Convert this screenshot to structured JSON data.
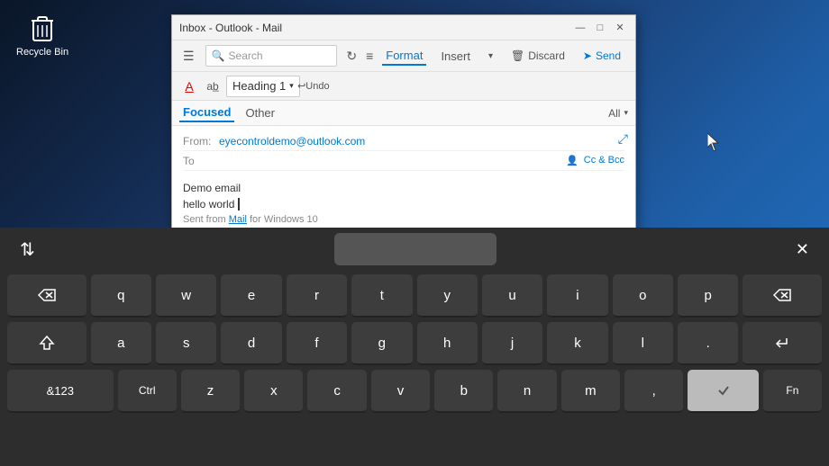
{
  "desktop": {
    "recycle_bin_label": "Recycle Bin"
  },
  "outlook": {
    "title": "Inbox - Outlook - Mail",
    "title_controls": {
      "minimize": "—",
      "maximize": "□",
      "close": "✕"
    },
    "toolbar": {
      "search_placeholder": "Search",
      "tabs": [
        "Format",
        "Insert"
      ],
      "discard_label": "Discard",
      "send_label": "Send"
    },
    "format_toolbar": {
      "heading_label": "Heading 1",
      "undo_label": "Undo"
    },
    "nav": {
      "tabs": [
        {
          "label": "Focused",
          "active": true
        },
        {
          "label": "Other",
          "active": false
        }
      ],
      "filter_label": "All"
    },
    "email": {
      "from_label": "From:",
      "from_value": "eyecontroldemo@outlook.com",
      "to_label": "To",
      "cc_bcc_label": "Cc & Bcc",
      "subject": "Demo email",
      "body_line1": "hello world",
      "body_cursor": "|",
      "signature": "Sent from Mail for Windows 10",
      "signature_link": "Mail"
    }
  },
  "keyboard": {
    "close_label": "✕",
    "rows": [
      [
        "q",
        "w",
        "e",
        "r",
        "t",
        "y",
        "u",
        "i",
        "o",
        "p"
      ],
      [
        "a",
        "s",
        "d",
        "f",
        "g",
        "h",
        "j",
        "k",
        "l",
        "."
      ],
      [
        "z",
        "x",
        "c",
        "v",
        "b",
        "n",
        "m",
        ","
      ]
    ],
    "special_keys": {
      "backspace": "⌫",
      "shift": "⇧",
      "enter": "↵",
      "space": "",
      "symbols": "&123",
      "ctrl": "Ctrl",
      "fn": "Fn",
      "sort": "⇅"
    }
  }
}
